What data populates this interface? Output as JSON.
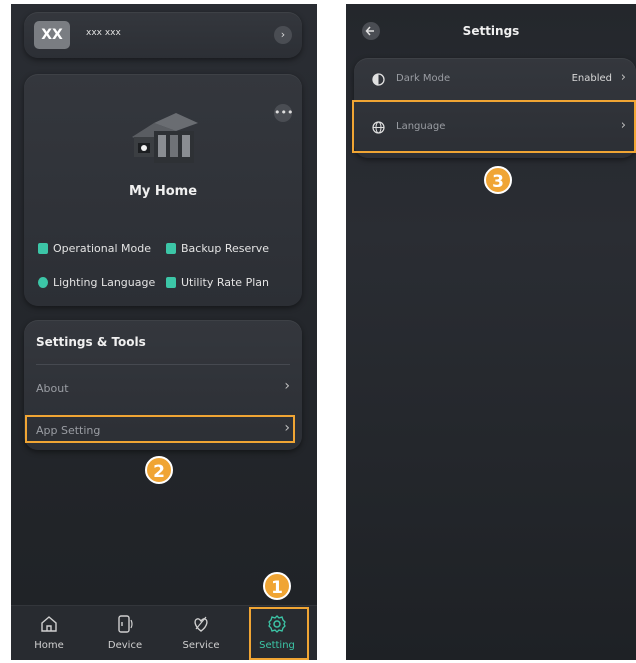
{
  "colors": {
    "accent": "#3cc6a7",
    "highlight": "#f0a534",
    "bg": "#2a2d33"
  },
  "left": {
    "user": {
      "avatar_text": "XX",
      "name": "xxx xxx"
    },
    "home": {
      "title": "My Home",
      "features": [
        {
          "label": "Operational Mode",
          "icon": "flag-icon"
        },
        {
          "label": "Backup Reserve",
          "icon": "battery-icon"
        },
        {
          "label": "Lighting Language",
          "icon": "bulb-icon"
        },
        {
          "label": "Utility Rate Plan",
          "icon": "bookmark-icon"
        }
      ]
    },
    "tools": {
      "title": "Settings & Tools",
      "items": [
        {
          "label": "About"
        },
        {
          "label": "App Setting"
        }
      ]
    },
    "tabs": [
      {
        "label": "Home",
        "icon": "home-icon"
      },
      {
        "label": "Device",
        "icon": "device-icon"
      },
      {
        "label": "Service",
        "icon": "service-icon"
      },
      {
        "label": "Setting",
        "icon": "gear-icon",
        "active": true
      }
    ]
  },
  "right": {
    "title": "Settings",
    "rows": [
      {
        "label": "Dark Mode",
        "value": "Enabled",
        "icon": "contrast-icon"
      },
      {
        "label": "Language",
        "value": "",
        "icon": "globe-icon"
      }
    ]
  },
  "steps": [
    "1",
    "2",
    "3"
  ]
}
